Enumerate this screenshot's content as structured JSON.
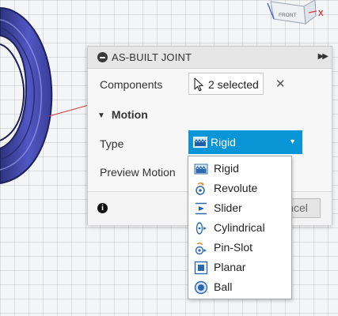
{
  "panel": {
    "title": "AS-BUILT JOINT",
    "components_label": "Components",
    "components_value": "2 selected",
    "clear_symbol": "✕",
    "motion_header": "Motion",
    "type_label": "Type",
    "type_value": "Rigid",
    "preview_label": "Preview Motion",
    "cancel_label": "ncel",
    "info_symbol": "i"
  },
  "dropdown": {
    "options": [
      {
        "label": "Rigid",
        "icon": "rigid-icon"
      },
      {
        "label": "Revolute",
        "icon": "revolute-icon"
      },
      {
        "label": "Slider",
        "icon": "slider-icon"
      },
      {
        "label": "Cylindrical",
        "icon": "cylindrical-icon"
      },
      {
        "label": "Pin-Slot",
        "icon": "pin-slot-icon"
      },
      {
        "label": "Planar",
        "icon": "planar-icon"
      },
      {
        "label": "Ball",
        "icon": "ball-icon"
      }
    ]
  },
  "viewcube": {
    "face_label": "FRONT",
    "axis_label": "X"
  },
  "colors": {
    "accent": "#0a96d6",
    "ring": "#4a4fb8",
    "axis_red": "#d33b3b"
  }
}
